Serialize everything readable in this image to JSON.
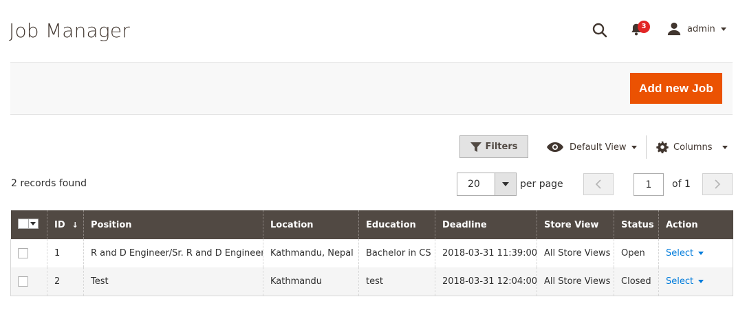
{
  "header": {
    "title": "Job Manager",
    "notifications_count": "3",
    "user_name": "admin"
  },
  "actions": {
    "add_label": "Add new Job"
  },
  "toolbar": {
    "filters_label": "Filters",
    "view_label": "Default View",
    "columns_label": "Columns",
    "records_found": "2 records found",
    "per_page_value": "20",
    "per_page_label": "per page",
    "current_page": "1",
    "page_of": "of 1"
  },
  "grid": {
    "columns": [
      "ID",
      "Position",
      "Location",
      "Education",
      "Deadline",
      "Store View",
      "Status",
      "Action"
    ],
    "sort_indicator": "↓",
    "rows": [
      {
        "id": "1",
        "position": "R and D Engineer/Sr. R and D Engineer",
        "location": "Kathmandu, Nepal",
        "education": "Bachelor in CS",
        "deadline": "2018-03-31 11:39:00",
        "store_view": "All Store Views",
        "status": "Open",
        "action": "Select"
      },
      {
        "id": "2",
        "position": "Test",
        "location": "Kathmandu",
        "education": "test",
        "deadline": "2018-03-31 12:04:00",
        "store_view": "All Store Views",
        "status": "Closed",
        "action": "Select"
      }
    ]
  },
  "colors": {
    "accent": "#eb5202",
    "header_bg": "#514943",
    "link": "#007bdb",
    "badge": "#e22626"
  },
  "icons": [
    "search-icon",
    "bell-icon",
    "user-icon",
    "filter-icon",
    "eye-icon",
    "gear-icon",
    "chevron-left-icon",
    "chevron-right-icon"
  ]
}
